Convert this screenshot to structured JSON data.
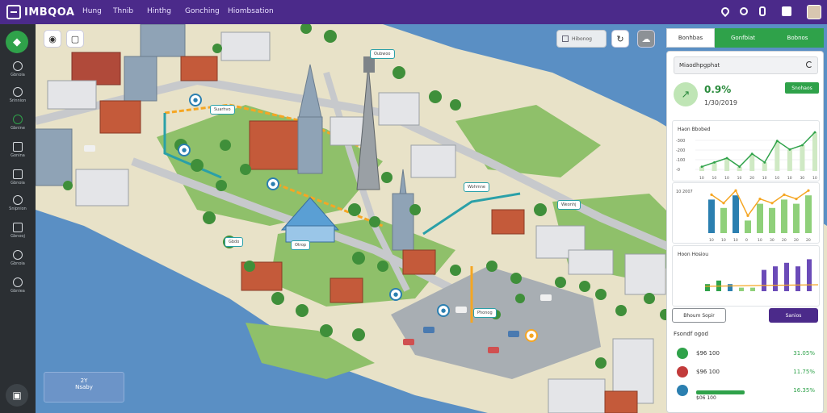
{
  "app": {
    "name": "IMBQOA"
  },
  "topnav": [
    "Hung",
    "Thnib",
    "Hinthg",
    "Gonching",
    "Hiombsation"
  ],
  "sidebar": {
    "items": [
      {
        "label": "Gbnoia",
        "icon": "clock-icon"
      },
      {
        "label": "Srinnion",
        "icon": "compass-icon"
      },
      {
        "label": "Gbnine",
        "icon": "search-icon"
      },
      {
        "label": "Gonina",
        "icon": "grid-icon"
      },
      {
        "label": "Gbnoia",
        "icon": "bag-icon"
      },
      {
        "label": "Snipnion",
        "icon": "leaf-icon"
      },
      {
        "label": "Gbnooj",
        "icon": "person-icon"
      },
      {
        "label": "Gbnoia",
        "icon": "recycle-icon"
      },
      {
        "label": "Gbniea",
        "icon": "chat-icon"
      }
    ]
  },
  "map": {
    "layer_chip": "Hibonog",
    "tags": [
      "Oubwoo",
      "Suarhvo",
      "Wohmne",
      "Weonhj",
      "Gbdo",
      "Otrop",
      "Phonog"
    ],
    "info_card": {
      "line1": "2Y",
      "line2": "Nsaby"
    }
  },
  "panel": {
    "tabs": [
      "Bonhbas",
      "Gonfbiat",
      "Bobnos"
    ],
    "header": "Miaodhpgphat",
    "kpi": {
      "value": "0.9%",
      "sub": "1/30/2019",
      "button": "Snohaos"
    },
    "charts": [
      {
        "title": "Haon Bbobed",
        "yticks": [
          "-300",
          "-200",
          "-100",
          "-0"
        ],
        "xticks": [
          "10",
          "10",
          "10",
          "10",
          "20",
          "10",
          "10",
          "10",
          "30",
          "10"
        ],
        "values": [
          1,
          2,
          3,
          1,
          4,
          2,
          7,
          5,
          6,
          9
        ]
      },
      {
        "ytick": "10 2007",
        "values": [
          8,
          6,
          9,
          3,
          7,
          6,
          8,
          7,
          9
        ],
        "xticks": [
          "10",
          "10",
          "10",
          "0",
          "10",
          "30",
          "20",
          "20",
          "20"
        ]
      },
      {
        "title": "Hoon Hosiou",
        "values": [
          2,
          3,
          2,
          1,
          1,
          6,
          7,
          8,
          7,
          9
        ]
      }
    ],
    "btn_left": "Bhoum Sopir",
    "btn_right": "Sanios",
    "list_title": "Fsondf ogod",
    "list": [
      {
        "label": "$96 100",
        "value": "31.05%",
        "color": "#2fa24a"
      },
      {
        "label": "$96 100",
        "value": "11.75%",
        "color": "#c23b3b"
      },
      {
        "label": "$06 100",
        "value": "16.35%",
        "color": "#2b7fb0"
      }
    ]
  },
  "colors": {
    "topbar": "#4b2a8a",
    "accent_green": "#2fa24a",
    "water": "#5a8fc4",
    "land": "#e8e2c8",
    "grass": "#8fc06a"
  }
}
